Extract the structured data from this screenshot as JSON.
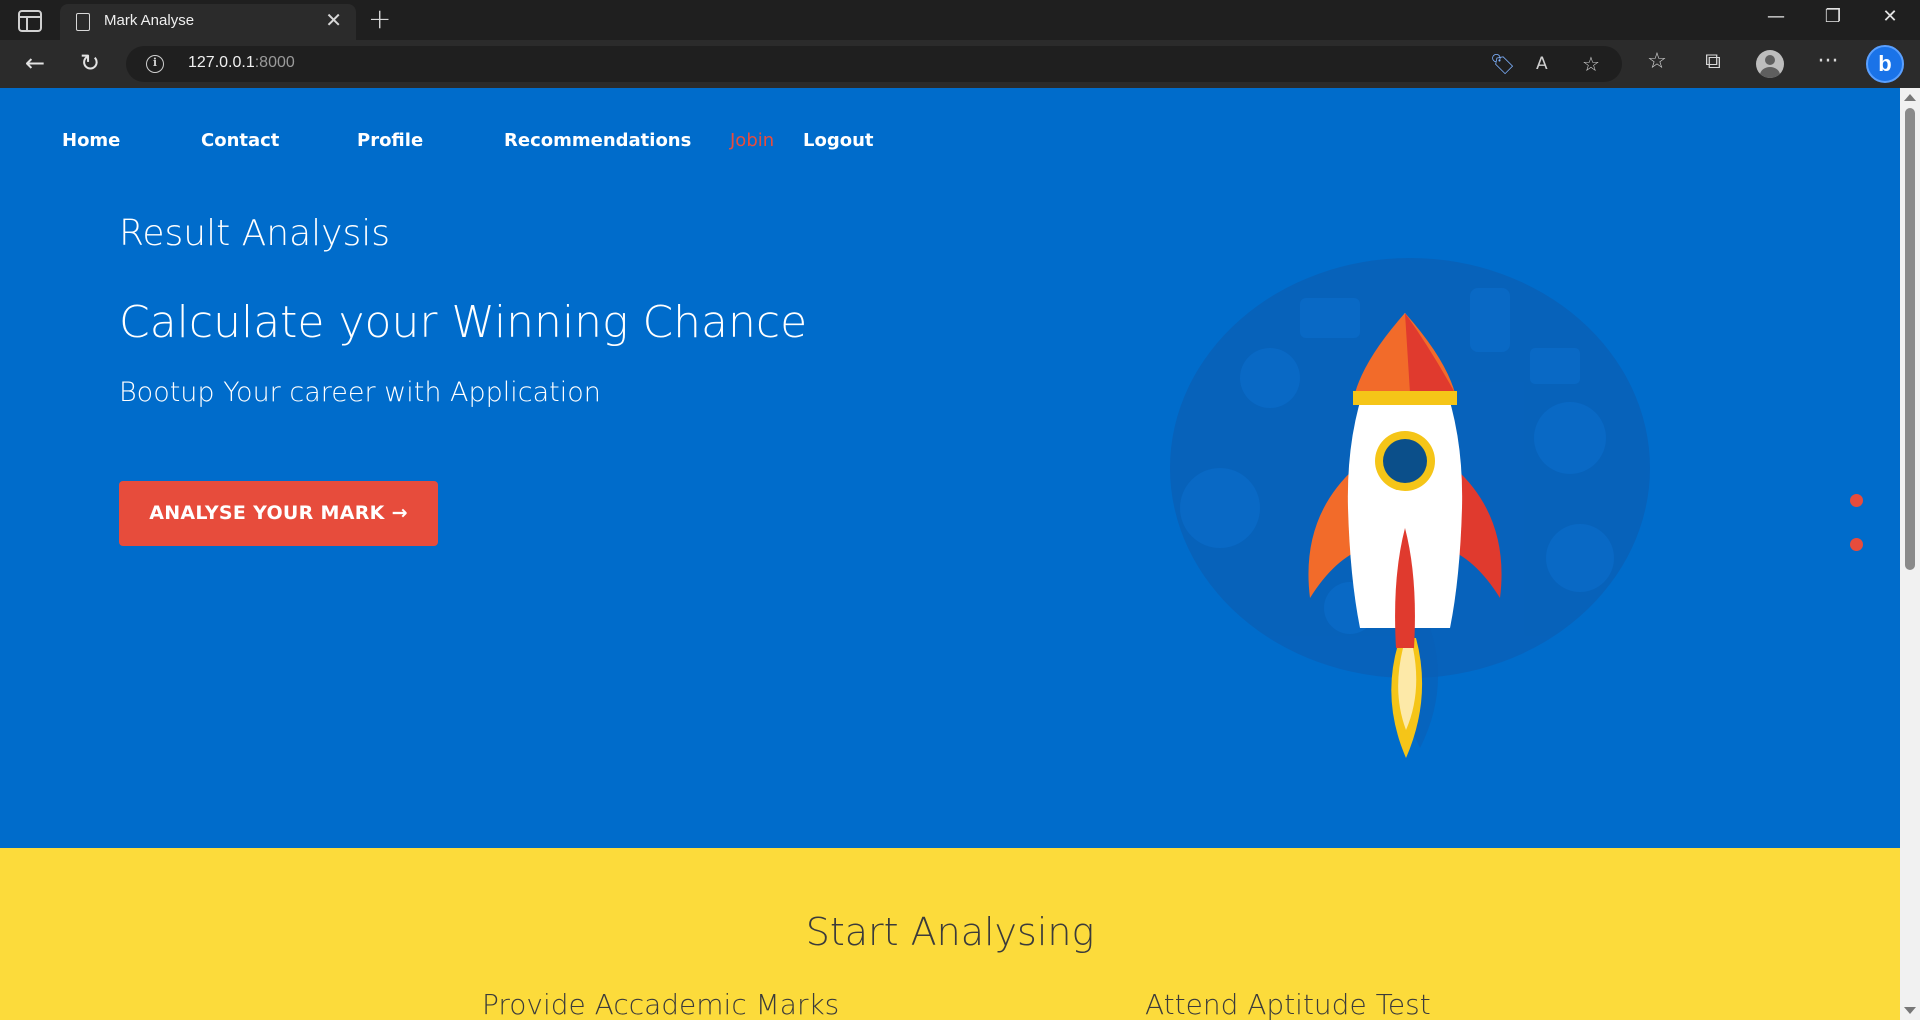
{
  "browser": {
    "tab_title": "Mark Analyse",
    "tab_close": "✕",
    "new_tab": "+",
    "url_host": "127.0.0.1",
    "url_port": ":8000",
    "window_minimize": "—",
    "window_restore": "❐",
    "window_close": "✕",
    "back": "←",
    "reload": "↻",
    "more": "···"
  },
  "nav": {
    "items": [
      {
        "label": "Home"
      },
      {
        "label": "Contact"
      },
      {
        "label": "Profile"
      },
      {
        "label": "Recommendations"
      }
    ],
    "user": "Jobin",
    "logout": "Logout"
  },
  "hero": {
    "brand": "Result Analysis",
    "title": "Calculate your Winning Chance",
    "subtitle": "Bootup Your career with Application",
    "cta_label": "ANALYSE YOUR MARK",
    "cta_arrow": "→"
  },
  "analyse": {
    "title": "Start Analysing",
    "items": [
      {
        "label": "Provide Accademic Marks"
      },
      {
        "label": "Attend Aptitude Test"
      }
    ]
  },
  "colors": {
    "hero_bg": "#006ccb",
    "accent": "#e74c3c",
    "section_bg": "#fcdb3b"
  }
}
